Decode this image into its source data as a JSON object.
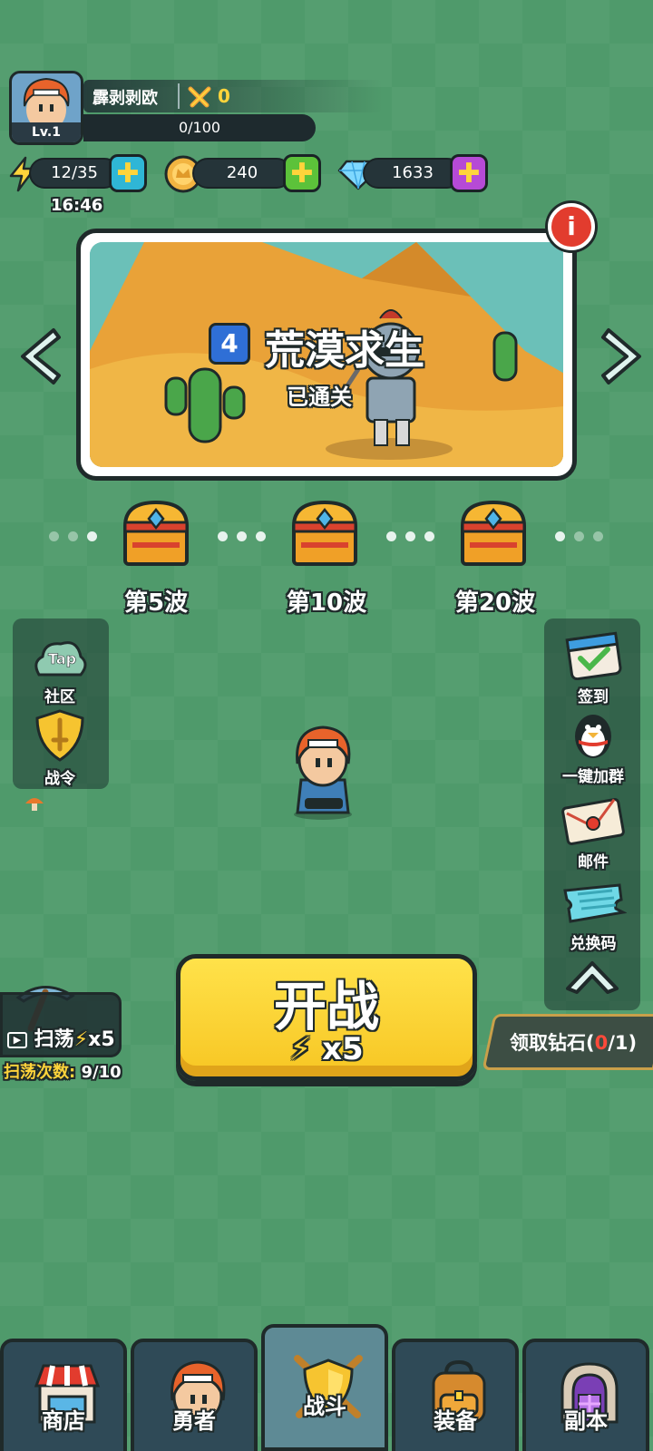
{
  "player": {
    "level": "Lv.1",
    "name": "霹剥剥欧",
    "power": "0",
    "xp": "0/100"
  },
  "resources": {
    "energy": "12/35",
    "energy_timer": "16:46",
    "gold": "240",
    "diamonds": "1633"
  },
  "stage": {
    "number": "4",
    "title": "荒漠求生",
    "status": "已通关"
  },
  "waves": [
    {
      "label": "第5波"
    },
    {
      "label": "第10波"
    },
    {
      "label": "第20波"
    }
  ],
  "left_menu": {
    "community": "社区",
    "tap_text": "Tap",
    "battle_pass": "战令"
  },
  "right_menu": {
    "checkin": "签到",
    "join_group": "一键加群",
    "mail": "邮件",
    "redeem": "兑换码"
  },
  "start": {
    "label": "开战",
    "cost": "x5"
  },
  "sweep": {
    "label": "扫荡",
    "cost": "x5",
    "count_label": "扫荡次数:",
    "count_value": "9/10"
  },
  "claim": {
    "label": "领取钻石(",
    "current": "0",
    "total": "/1)"
  },
  "nav": {
    "shop": "商店",
    "hero": "勇者",
    "battle": "战斗",
    "equipment": "装备",
    "dungeon": "副本"
  },
  "colors": {
    "background": "#4f9a6b",
    "start_button": "#f7c623",
    "energy_plus": "#2fb6d6",
    "gold_plus": "#5cc23a",
    "diamond_plus": "#b64ad6"
  }
}
